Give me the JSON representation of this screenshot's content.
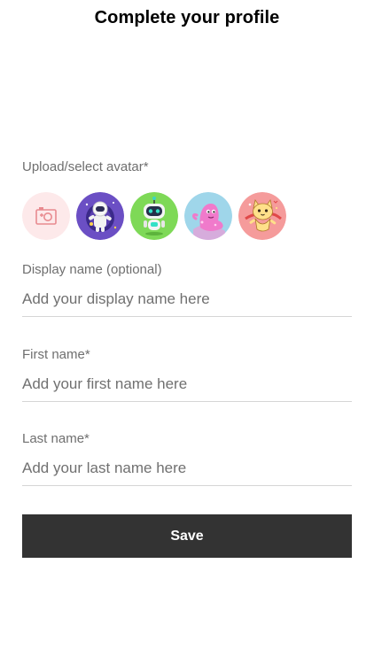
{
  "header": {
    "title": "Complete your profile"
  },
  "avatar": {
    "label": "Upload/select avatar*",
    "options": [
      {
        "name": "upload-photo",
        "icon": "camera-icon",
        "bg": "#fde9ea"
      },
      {
        "name": "astronaut",
        "icon": "astronaut-icon",
        "bg": "#6b4fc4"
      },
      {
        "name": "robot",
        "icon": "robot-icon",
        "bg": "#7ed957"
      },
      {
        "name": "pink-monster",
        "icon": "monster-icon",
        "bg": "#9fd6ea"
      },
      {
        "name": "cat",
        "icon": "cat-icon",
        "bg": "#f59b9b"
      }
    ]
  },
  "form": {
    "display_name": {
      "label": "Display name (optional)",
      "placeholder": "Add your display name here",
      "value": ""
    },
    "first_name": {
      "label": "First name*",
      "placeholder": "Add your first name here",
      "value": ""
    },
    "last_name": {
      "label": "Last name*",
      "placeholder": "Add your last name here",
      "value": ""
    }
  },
  "actions": {
    "save_label": "Save"
  },
  "colors": {
    "button_bg": "#333333",
    "label_text": "#6f6f6f",
    "divider": "#d5d5d5"
  }
}
